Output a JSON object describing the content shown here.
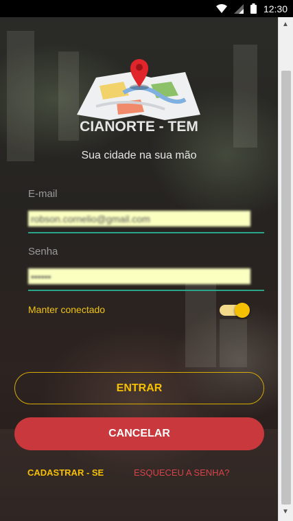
{
  "status_bar": {
    "time": "12:30",
    "icons": [
      "wifi-icon",
      "signal-icon",
      "battery-icon"
    ]
  },
  "app": {
    "title": "CIANORTE - TEM",
    "subtitle": "Sua cidade na sua mão",
    "email": {
      "label": "E-mail",
      "value": "robson.cornelio@gmail.com"
    },
    "password": {
      "label": "Senha",
      "value": "••••••"
    },
    "keep_connected": {
      "label": "Manter conectado",
      "checked": true
    },
    "buttons": {
      "enter": "ENTRAR",
      "cancel": "CANCELAR"
    },
    "links": {
      "register": "CADASTRAR - SE",
      "forgot": "ESQUECEU A SENHA?"
    },
    "colors": {
      "accent_yellow": "#f5c000",
      "cancel_red": "#c9383c",
      "link_red": "#d6444a",
      "underline_green": "#2aa58a",
      "field_bg": "#fbffc0"
    }
  }
}
